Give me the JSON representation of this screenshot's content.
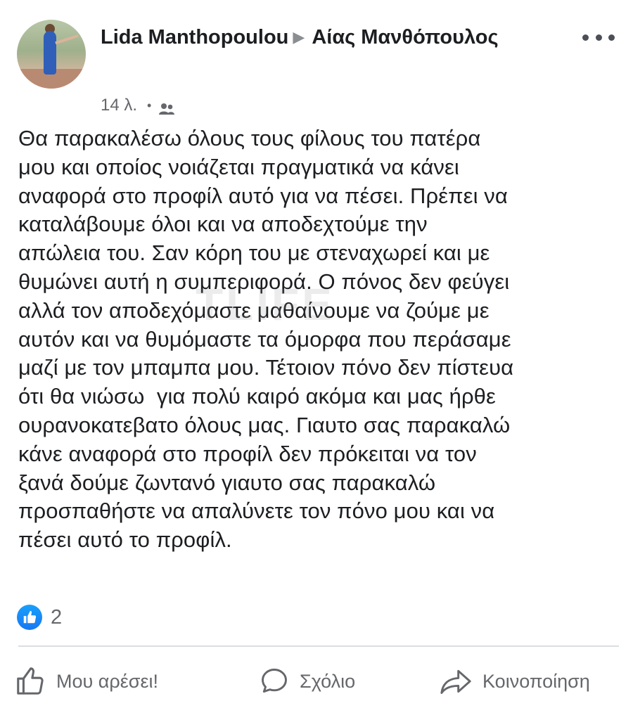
{
  "post": {
    "author": "Lida Manthopoulou",
    "recipient": "Αίας Μανθόπουλος",
    "timestamp": "14 λ.",
    "audience_icon": "friends-icon",
    "more_icon": "more-horizontal-icon",
    "text": "Θα παρακαλέσω όλους τους φίλους του πατέρα\nμου και οποίος νοιάζεται πραγματικά να κάνει\nαναφορά στο προφίλ αυτό για να πέσει. Πρέπει να\nκαταλάβουμε όλοι και να αποδεχτούμε την\nαπώλεια του. Σαν κόρη του με στεναχωρεί και με\nθυμώνει αυτή η συμπεριφορά. Ο πόνος δεν φεύγει\nαλλά τον αποδεχόμαστε μαθαίνουμε να ζούμε με\nαυτόν και να θυμόμαστε τα όμορφα που περάσαμε\nμαζί με τον μπαμπα μου. Τέτοιον πόνο δεν πίστευα\nότι θα νιώσω  για πολύ καιρό ακόμα και μας ήρθε\nουρανοκατεβατο όλους μας. Γιαυτο σας παρακαλώ\nκάνε αναφορά στο προφίλ δεν πρόκειται να τον\nξανά δούμε ζωντανό γιαυτο σας παρακαλώ\nπροσπαθήστε να απαλύνετε τον πόνο μου και να\nπέσει αυτό το προφίλ.",
    "watermark": "TLIFE"
  },
  "reactions": {
    "icon": "like-reaction-icon",
    "count": "2"
  },
  "actions": {
    "like_label": "Μου αρέσει!",
    "comment_label": "Σχόλιο",
    "share_label": "Κοινοποίηση"
  },
  "colors": {
    "like_blue": "#1877f2",
    "secondary_text": "#65676b",
    "primary_text": "#1c1e21",
    "divider": "#dadde1"
  }
}
